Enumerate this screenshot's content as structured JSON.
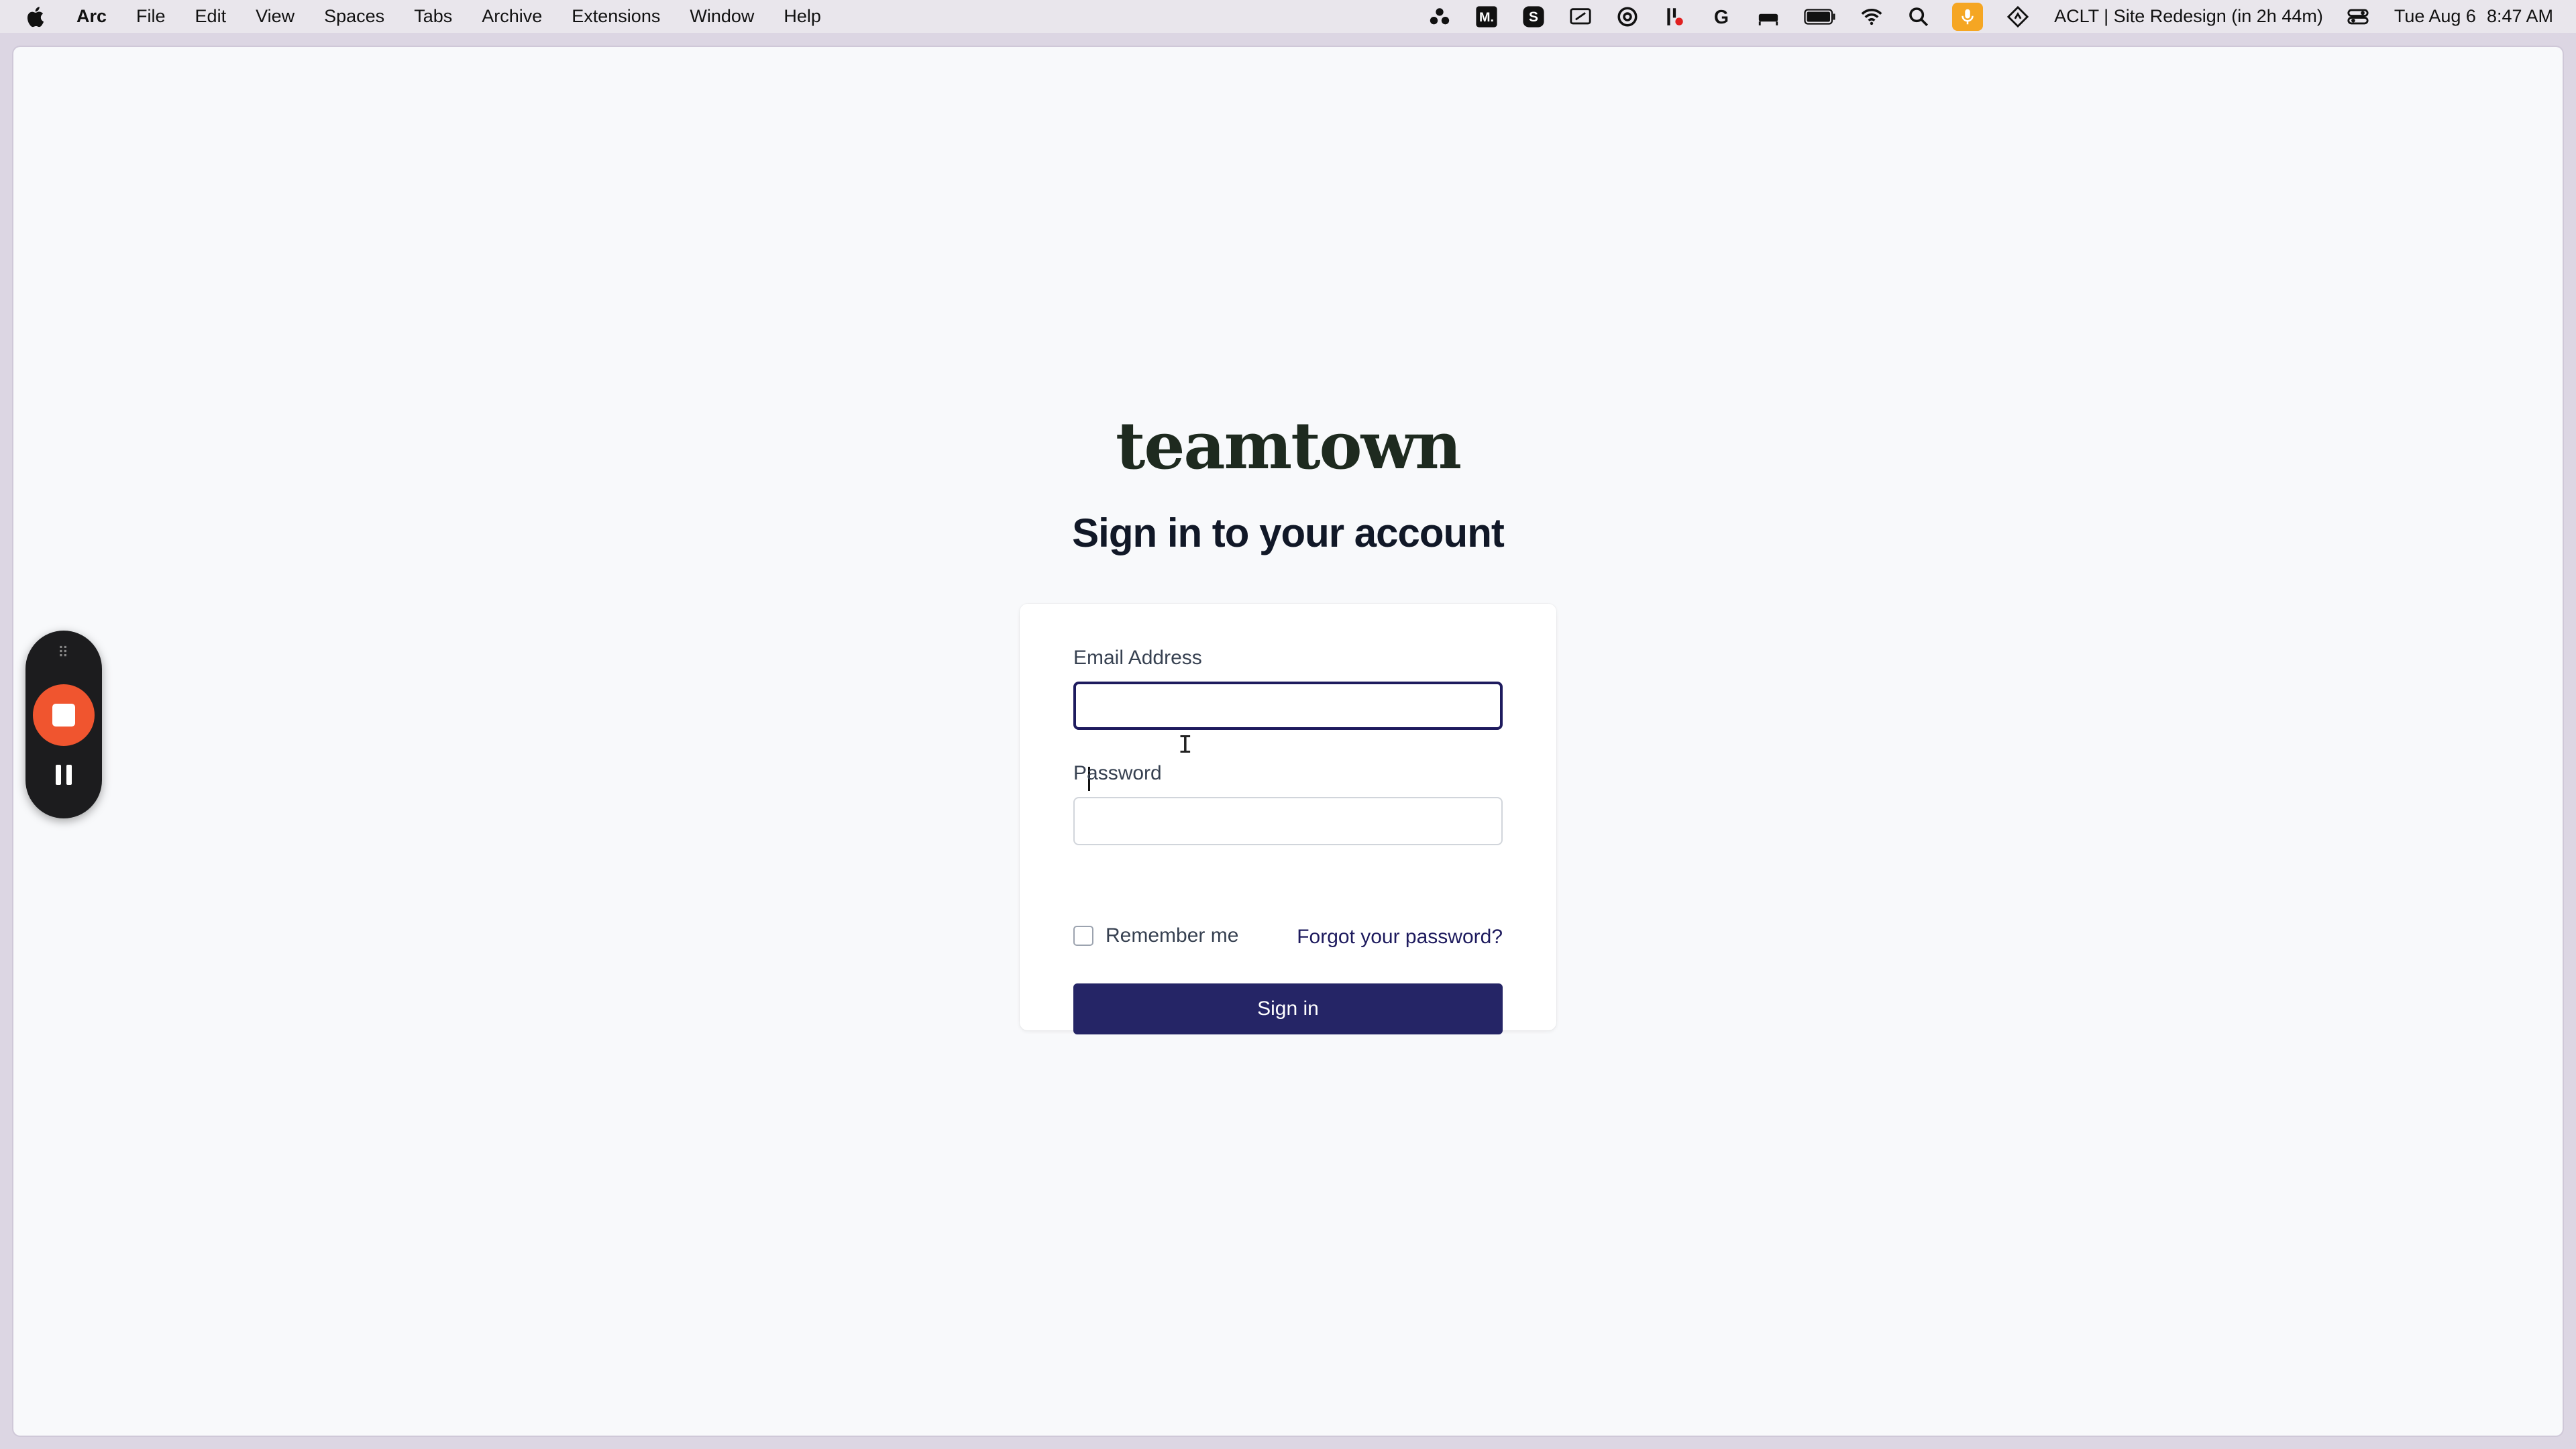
{
  "menubar": {
    "app_name": "Arc",
    "items": [
      "File",
      "Edit",
      "View",
      "Spaces",
      "Tabs",
      "Archive",
      "Extensions",
      "Window",
      "Help"
    ],
    "calendar_event": "ACLT | Site Redesign (in 2h 44m)",
    "date": "Tue Aug 6",
    "time": "8:47 AM",
    "tray_icons": [
      "cluster-icon",
      "medium-icon",
      "s-app-icon",
      "screen-share-icon",
      "at-sign-icon",
      "tools-icon",
      "grammarly-icon",
      "bed-icon",
      "battery-icon",
      "wifi-icon",
      "search-icon",
      "microphone-icon",
      "location-icon",
      "control-center-icon"
    ],
    "mic_color": "#f5a623"
  },
  "page": {
    "logo": "teamtown",
    "heading": "Sign in to your account"
  },
  "form": {
    "email_label": "Email Address",
    "email_value": "",
    "password_label": "Password",
    "password_value": "",
    "remember_label": "Remember me",
    "remember_checked": false,
    "forgot_link": "Forgot your password?",
    "submit_label": "Sign in",
    "accent_color": "#252566"
  },
  "recorder": {
    "grip_icon": "drag-grip-icon",
    "stop_icon": "stop-icon",
    "pause_icon": "pause-icon",
    "stop_color": "#f0552f"
  }
}
